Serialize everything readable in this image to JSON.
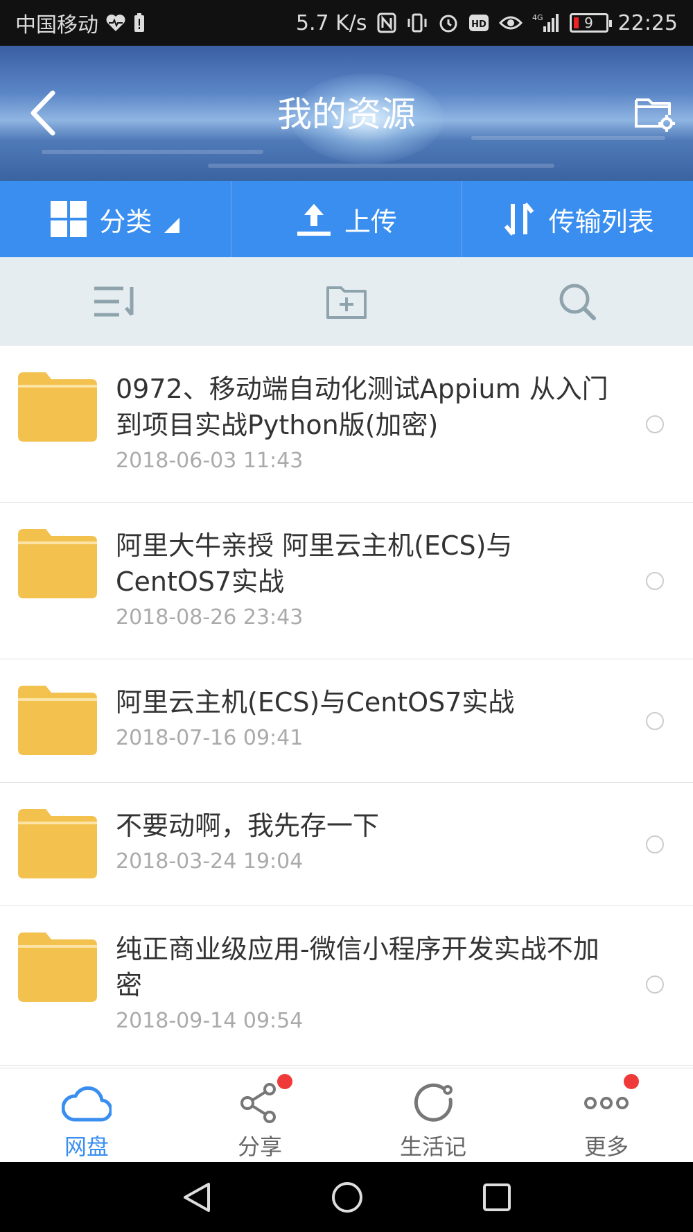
{
  "status_bar": {
    "carrier": "中国移动",
    "speed": "5.7 K/s",
    "network": "4G",
    "battery": "9",
    "time": "22:25"
  },
  "header": {
    "title": "我的资源"
  },
  "actions": [
    {
      "label": "分类",
      "icon": "grid-icon"
    },
    {
      "label": "上传",
      "icon": "upload-icon"
    },
    {
      "label": "传输列表",
      "icon": "transfer-icon"
    }
  ],
  "files": [
    {
      "title": "0972、移动端自动化测试Appium 从入门到项目实战Python版(加密)",
      "date": "2018-06-03  11:43"
    },
    {
      "title": "阿里大牛亲授 阿里云主机(ECS)与CentOS7实战",
      "date": "2018-08-26  23:43"
    },
    {
      "title": "阿里云主机(ECS)与CentOS7实战",
      "date": "2018-07-16  09:41"
    },
    {
      "title": "不要动啊，我先存一下",
      "date": "2018-03-24  19:04"
    },
    {
      "title": "纯正商业级应用-微信小程序开发实战不加密",
      "date": "2018-09-14  09:54"
    }
  ],
  "bottom_nav": [
    {
      "label": "网盘",
      "active": true,
      "badge": false
    },
    {
      "label": "分享",
      "active": false,
      "badge": true
    },
    {
      "label": "生活记",
      "active": false,
      "badge": false
    },
    {
      "label": "更多",
      "active": false,
      "badge": true
    }
  ],
  "colors": {
    "accent": "#3a8ef0",
    "folder": "#f2c14e",
    "badge": "#f03a3a"
  }
}
